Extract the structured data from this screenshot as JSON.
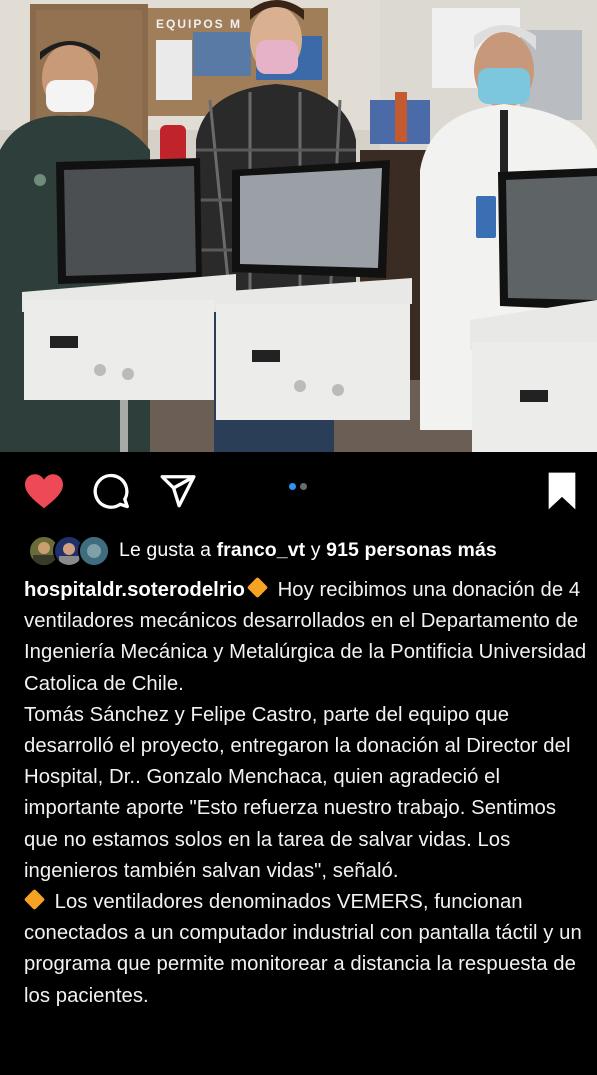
{
  "post": {
    "likes": {
      "prefix": "Le gusta a ",
      "user": "franco_vt",
      "middle": " y ",
      "count_text": "915 personas más"
    },
    "caption": {
      "username": "hospitaldr.soterodelrio",
      "para1": " Hoy recibimos una donación de 4 ventiladores mecánicos desarrollados en el Departamento de Ingeniería Mecánica y Metalúrgica de la Pontificia Universidad Catolica de Chile.",
      "para2": "Tomás Sánchez y Felipe Castro, parte del equipo que desarrolló el proyecto, entregaron la donación al Director del Hospital, Dr.. Gonzalo Menchaca, quien agradeció el importante aporte \"Esto refuerza nuestro trabajo. Sentimos que no estamos solos en la tarea de salvar vidas. Los ingenieros también salvan vidas\", señaló.",
      "para3": " Los ventiladores denominados VEMERS, funcionan conectados a un computador industrial con pantalla táctil y un programa que permite monitorear a distancia la respuesta de los pacientes."
    },
    "carousel": {
      "total": 2,
      "current": 1
    },
    "colors": {
      "like": "#ed4956",
      "dot_active": "#2f93f5",
      "diamond": "#f6a323"
    }
  },
  "photo": {
    "board_text": "EQUIPOS M"
  },
  "icons": [
    "heart-icon",
    "comment-icon",
    "share-icon",
    "bookmark-icon"
  ]
}
